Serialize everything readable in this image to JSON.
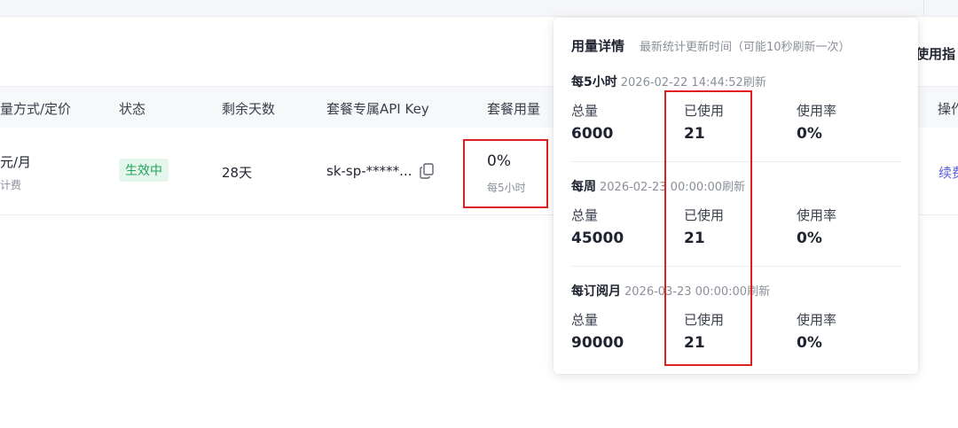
{
  "header": {
    "guide_label": "使用指"
  },
  "table": {
    "columns": [
      "量方式/定价",
      "状态",
      "剩余天数",
      "套餐专属API Key",
      "套餐用量",
      "操作"
    ],
    "row": {
      "price": "元/月",
      "price_sub": "计费",
      "status": "生效中",
      "days": "28天",
      "api_key": "sk-sp-*****...",
      "usage_value": "0%",
      "usage_period": "每5小时",
      "action": "续费"
    }
  },
  "popover": {
    "title": "用量详情",
    "note": "最新统计更新时间（可能10秒刷新一次）",
    "labels": {
      "total": "总量",
      "used": "已使用",
      "rate": "使用率"
    },
    "sections": [
      {
        "name": "每5小时",
        "time": "2026-02-22 14:44:52刷新",
        "total": "6000",
        "used": "21",
        "rate": "0%"
      },
      {
        "name": "每周",
        "time": "2026-02-23 00:00:00刷新",
        "total": "45000",
        "used": "21",
        "rate": "0%"
      },
      {
        "name": "每订阅月",
        "time": "2026-03-23 00:00:00刷新",
        "total": "90000",
        "used": "21",
        "rate": "0%"
      }
    ]
  },
  "colors": {
    "highlight": "#e02020",
    "status": "#22a35a",
    "link": "#5b61e0"
  },
  "icons": [
    "copy-icon"
  ]
}
